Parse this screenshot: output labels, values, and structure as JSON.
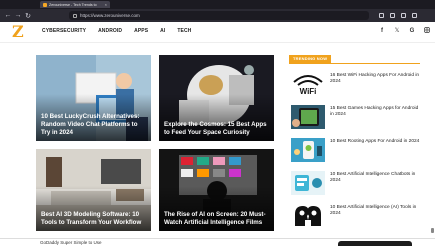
{
  "browser": {
    "tab_title": "Zerouniverse - Tech Trends to",
    "url": "https://www.zerouniverse.com"
  },
  "site": {
    "logo_letter": "Z",
    "nav": [
      "CYBERSECURITY",
      "ANDROID",
      "APPS",
      "AI",
      "TECH"
    ],
    "social_icons": [
      "facebook-icon",
      "x-icon",
      "google-icon",
      "instagram-icon"
    ]
  },
  "articles": [
    {
      "title": "10 Best LuckyCrush Alternatives: Random Video Chat Platforms to Try in 2024"
    },
    {
      "title": "Explore the Cosmos: 15 Best Apps to Feed Your Space Curiosity"
    },
    {
      "title": "Best AI 3D Modeling Software: 10 Tools to Transform Your Workflow"
    },
    {
      "title": "The Rise of AI on Screen: 20 Must-Watch Artificial Intelligence Films"
    }
  ],
  "sidebar": {
    "heading": "TRENDING NOW",
    "items": [
      {
        "title": "16 Best WiFi Hacking Apps For Android in 2024",
        "thumb": "wifi-logo"
      },
      {
        "title": "15 Best Games Hacking Apps for Android in 2024",
        "thumb": "phone-game"
      },
      {
        "title": "10 Best Rooting Apps For Android in 2024",
        "thumb": "rooting-illustration"
      },
      {
        "title": "10 Best Artificial Intelligence Chatbots in 2024",
        "thumb": "chatbot-illustration"
      },
      {
        "title": "10 Best Artificial Intelligence (AI) Tools in 2024",
        "thumb": "ai-heads"
      }
    ]
  },
  "ad": {
    "text": "GoDaddy Super Simple to Use"
  },
  "colors": {
    "accent": "#f0a21d",
    "browser_dark": "#1c1b22",
    "toolbar": "#2b2a33"
  }
}
